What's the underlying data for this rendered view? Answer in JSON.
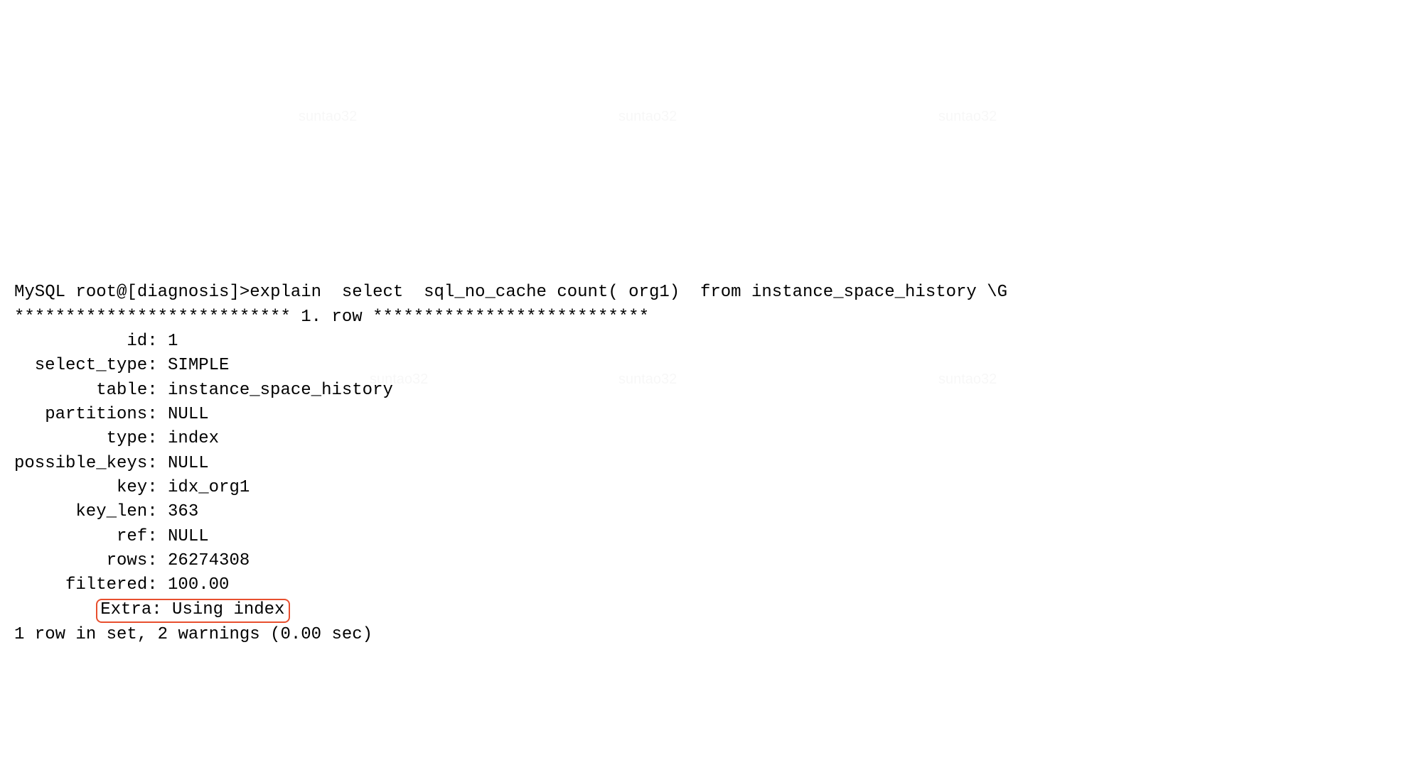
{
  "prompt": "MySQL root@[diagnosis]>",
  "command": "explain  select  sql_no_cache count( org1)  from instance_space_history \\G",
  "row_separator_left": "***************************",
  "row_num_label": "1. row",
  "row_separator_right": "***************************",
  "fields": [
    {
      "label": "id",
      "value": "1"
    },
    {
      "label": "select_type",
      "value": "SIMPLE"
    },
    {
      "label": "table",
      "value": "instance_space_history"
    },
    {
      "label": "partitions",
      "value": "NULL"
    },
    {
      "label": "type",
      "value": "index"
    },
    {
      "label": "possible_keys",
      "value": "NULL"
    },
    {
      "label": "key",
      "value": "idx_org1"
    },
    {
      "label": "key_len",
      "value": "363"
    },
    {
      "label": "ref",
      "value": "NULL"
    },
    {
      "label": "rows",
      "value": "26274308"
    },
    {
      "label": "filtered",
      "value": "100.00"
    },
    {
      "label": "Extra",
      "value": "Using index",
      "highlight": true
    }
  ],
  "footer": "1 row in set, 2 warnings (0.00 sec)"
}
